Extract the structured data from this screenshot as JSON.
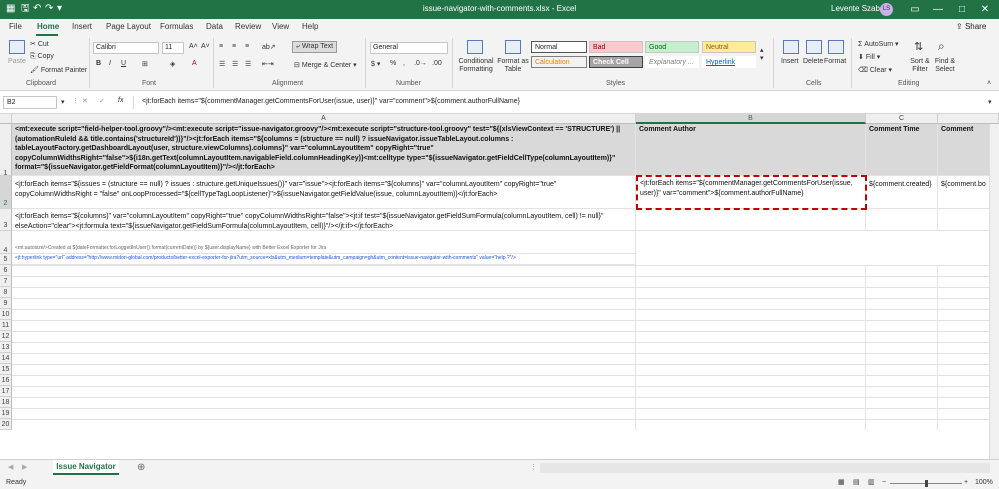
{
  "window": {
    "title": "issue-navigator-with-comments.xlsx  -  Excel",
    "user": "Levente Szabo",
    "avatar_initials": "LS"
  },
  "tabs": [
    "File",
    "Home",
    "Insert",
    "Page Layout",
    "Formulas",
    "Data",
    "Review",
    "View",
    "Help"
  ],
  "share_label": "Share",
  "ribbon": {
    "clipboard": {
      "paste": "Paste",
      "cut": "Cut",
      "copy": "Copy",
      "format_painter": "Format Painter",
      "group": "Clipboard"
    },
    "font": {
      "name": "Calibri",
      "size": "11",
      "group": "Font"
    },
    "alignment": {
      "wrap": "Wrap Text",
      "merge": "Merge & Center",
      "group": "Alignment"
    },
    "number": {
      "format": "General",
      "group": "Number"
    },
    "styles": {
      "conditional": "Conditional Formatting",
      "format_table": "Format as Table",
      "items": [
        "Normal",
        "Bad",
        "Good",
        "Neutral",
        "Calculation",
        "Check Cell",
        "Explanatory ...",
        "Hyperlink"
      ],
      "group": "Styles"
    },
    "cells": {
      "insert": "Insert",
      "delete": "Delete",
      "format": "Format",
      "group": "Cells"
    },
    "editing": {
      "autosum": "AutoSum",
      "fill": "Fill",
      "clear": "Clear",
      "sort": "Sort & Filter",
      "find": "Find & Select",
      "group": "Editing"
    }
  },
  "formula_bar": {
    "cell_ref": "B2",
    "formula": "<jt:forEach items=\"${commentManager.getCommentsForUser(issue, user)}\" var=\"comment\">${comment.authorFullName}"
  },
  "columns": [
    "A",
    "B",
    "C"
  ],
  "rows": [
    "1",
    "2",
    "3",
    "4",
    "5",
    "6",
    "7",
    "8",
    "9",
    "10",
    "11",
    "12",
    "13",
    "14",
    "15",
    "16",
    "17",
    "18",
    "19",
    "20"
  ],
  "cells": {
    "a1": "<mt:execute script=\"field-helper-tool.groovy\"/><mt:execute script=\"issue-navigator.groovy\"/><mt:execute script=\"structure-tool.groovy\" test=\"${(xlsViewContext == 'STRUCTURE') || (automationRuleId && title.contains('structureId'))}\"/><jt:forEach items=\"${columns = (structure == null) ? issueNavigator.issueTableLayout.columns : tableLayoutFactory.getDashboardLayout(user, structure.viewColumns).columns}\" var=\"columnLayoutItem\" copyRight=\"true\" copyColumnWidthsRight=\"false\">${i18n.getText(columnLayoutItem.navigableField.columnHeadingKey)}<mt:celltype type=\"${issueNavigator.getFieldCellType(columnLayoutItem)}\" format=\"${issueNavigator.getFieldFormat(columnLayoutItem)}\"/></jt:forEach>",
    "b1": "Comment Author",
    "c1": "Comment Time",
    "d1": "Comment",
    "a2": "<jt:forEach items=\"${issues = (structure == null) ? issues : structure.getUniqueIssues()}\" var=\"issue\"><jt:forEach items=\"${columns}\" var=\"columnLayoutItem\" copyRight=\"true\" copyColumnWidthsRight = \"false\" onLoopProcessed=\"${cellTypeTagLoopListener}\">${issueNavigator.getFieldValue(issue, columnLayoutItem)}</jt:forEach>",
    "b2": "<jt:forEach items=\"${commentManager.getCommentsForUser(issue, user)}\" var=\"comment\">${comment.authorFullName}",
    "c2": "${comment.created}",
    "d2": "${comment.bo",
    "a3": "<jt:forEach items=\"${columns}\" var=\"columnLayoutItem\" copyRight=\"true\" copyColumnWidthsRight=\"false\"><jt:if test=\"${issueNavigator.getFieldSumFormula(columnLayoutItem, cell) != null}\" elseAction=\"clear\"><jt:formula text=\"${issueNavigator.getFieldSumFormula(columnLayoutItem, cell)}\"/></jt:if></jt:forEach>",
    "a4": "<mt:autosize/>Created at ${dateFormatter.forLoggedInUser().format(currentDate)} by ${user.displayName} with Better Excel Exporter for Jira",
    "a5": "<jt:hyperlink type=\"url\" address=\"http://www.midori-global.com/products/better-excel-exporter-for-jira?utm_source=xls&utm_medium=template&utm_campaign=gh&utm_content=issue-navigator-with-comments\" value=\"help ?\"/>"
  },
  "sheet_tab": "Issue Navigator",
  "status": {
    "ready": "Ready",
    "zoom": "100%"
  },
  "colors": {
    "excel_green": "#217346",
    "selection_red": "#c00000"
  }
}
